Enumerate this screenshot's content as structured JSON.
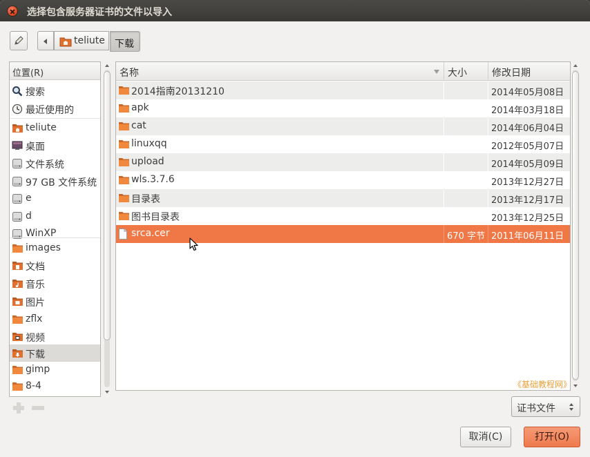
{
  "window": {
    "title": "选择包含服务器证书的文件以导入"
  },
  "pathbar": {
    "crumbs": [
      "teliute",
      "下载"
    ]
  },
  "places": {
    "header": "位置(R)",
    "items": [
      {
        "label": "搜索",
        "icon": "search-icon"
      },
      {
        "label": "最近使用的",
        "icon": "clock-icon"
      },
      {
        "label": "teliute",
        "icon": "home-folder-icon"
      },
      {
        "label": "桌面",
        "icon": "desktop-icon"
      },
      {
        "label": "文件系统",
        "icon": "drive-icon"
      },
      {
        "label": "97 GB 文件系统",
        "icon": "drive-icon"
      },
      {
        "label": "e",
        "icon": "drive-icon"
      },
      {
        "label": "d",
        "icon": "drive-icon"
      },
      {
        "label": "WinXP",
        "icon": "drive-icon"
      },
      {
        "label": "images",
        "icon": "folder-icon"
      },
      {
        "label": "文档",
        "icon": "documents-folder-icon"
      },
      {
        "label": "音乐",
        "icon": "music-folder-icon"
      },
      {
        "label": "图片",
        "icon": "pictures-folder-icon"
      },
      {
        "label": "zflx",
        "icon": "folder-icon"
      },
      {
        "label": "视频",
        "icon": "videos-folder-icon"
      },
      {
        "label": "下载",
        "icon": "downloads-folder-icon",
        "selected": true
      },
      {
        "label": "gimp",
        "icon": "folder-icon"
      },
      {
        "label": "8-4",
        "icon": "folder-icon"
      }
    ]
  },
  "files": {
    "columns": {
      "name": "名称",
      "size": "大小",
      "modified": "修改日期"
    },
    "rows": [
      {
        "name": "2014指南20131210",
        "size": "",
        "modified": "2014年05月08日",
        "type": "folder"
      },
      {
        "name": "apk",
        "size": "",
        "modified": "2014年03月18日",
        "type": "folder"
      },
      {
        "name": "cat",
        "size": "",
        "modified": "2014年06月04日",
        "type": "folder"
      },
      {
        "name": "linuxqq",
        "size": "",
        "modified": "2012年05月07日",
        "type": "folder"
      },
      {
        "name": "upload",
        "size": "",
        "modified": "2014年05月09日",
        "type": "folder"
      },
      {
        "name": "wls.3.7.6",
        "size": "",
        "modified": "2013年12月27日",
        "type": "folder"
      },
      {
        "name": "目录表",
        "size": "",
        "modified": "2013年12月17日",
        "type": "folder"
      },
      {
        "name": "图书目录表",
        "size": "",
        "modified": "2013年12月25日",
        "type": "folder"
      },
      {
        "name": "srca.cer",
        "size": "670 字节",
        "modified": "2011年06月11日",
        "type": "file",
        "selected": true
      }
    ]
  },
  "watermark": "《基础教程网》",
  "filter": {
    "selected": "证书文件"
  },
  "buttons": {
    "cancel": "取消(C)",
    "open": "打开(O)"
  },
  "colors": {
    "selection": "#f07746",
    "titlebar": "#3c3b37",
    "folder": "#f0883e"
  }
}
